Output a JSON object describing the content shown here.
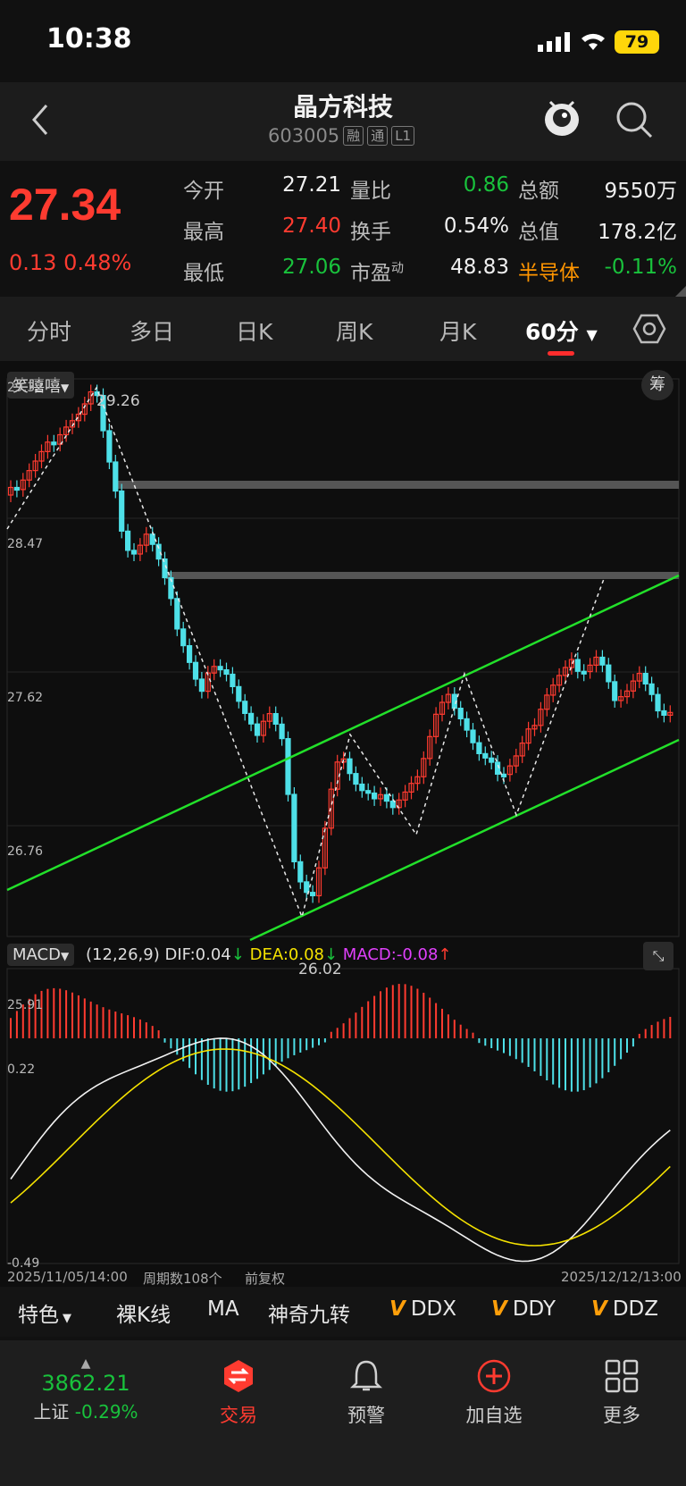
{
  "status": {
    "time": "10:38",
    "battery": "79"
  },
  "header": {
    "name": "晶方科技",
    "code": "603005",
    "tags": [
      "融",
      "通",
      "L1"
    ]
  },
  "quote": {
    "price": "27.34",
    "change": "0.13",
    "change_pct": "0.48%",
    "rows": [
      [
        {
          "l": "今开",
          "v": "27.21",
          "c": "white"
        },
        {
          "l": "量比",
          "v": "0.86",
          "c": "green"
        },
        {
          "l": "总额",
          "v": "9550万",
          "c": "white"
        }
      ],
      [
        {
          "l": "最高",
          "v": "27.40",
          "c": "red"
        },
        {
          "l": "换手",
          "v": "0.54%",
          "c": "white"
        },
        {
          "l": "总值",
          "v": "178.2亿",
          "c": "white"
        }
      ],
      [
        {
          "l": "最低",
          "v": "27.06",
          "c": "green"
        },
        {
          "l": "市盈",
          "v": "48.83",
          "c": "white"
        },
        {
          "l": "半导体",
          "v": "-0.11%",
          "c": "green"
        }
      ]
    ],
    "pe_sup": "动"
  },
  "tabs": [
    "分时",
    "多日",
    "日K",
    "周K",
    "月K",
    "60分"
  ],
  "chart": {
    "indicator_name": "笑嘻嘻",
    "chip_button": "筹",
    "price_ticks": [
      "29.32",
      "28.47",
      "27.62",
      "26.76",
      "25.91"
    ],
    "high_label": "29.26",
    "low_label": "26.02",
    "macd_selector": "MACD",
    "macd_params": "(12,26,9)",
    "dif": "DIF:0.04",
    "dea": "DEA:0.08",
    "macd": "MACD:-0.08",
    "macd_ticks": [
      "0.22",
      "-0.49"
    ],
    "start_date": "2025/11/05/14:00",
    "period": "周期数108个",
    "adjust": "前复权",
    "end_date": "2025/12/12/13:00"
  },
  "chart_data": {
    "type": "candlestick",
    "ylim": [
      25.91,
      29.32
    ],
    "macd_ylim": [
      -0.49,
      0.22
    ]
  },
  "indicators": [
    "特色",
    "裸K线",
    "MA",
    "神奇九转",
    "DDX",
    "DDY",
    "DDZ"
  ],
  "nav": {
    "index_value": "3862.21",
    "index_name": "上证",
    "index_change": "-0.29%",
    "items": [
      "交易",
      "预警",
      "加自选",
      "更多"
    ]
  }
}
